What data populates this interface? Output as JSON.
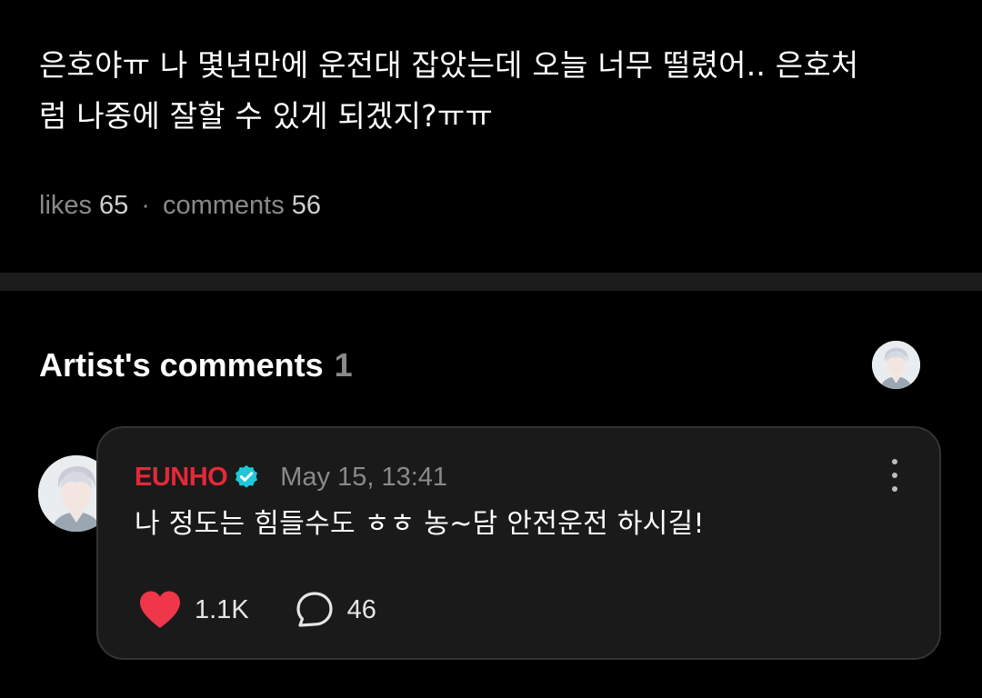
{
  "post": {
    "text_line1": "은호야ㅠ 나 몇년만에 운전대 잡았는데 오늘 너무 떨렸어.. 은호처",
    "text_line2": "럼 나중에 잘할 수 있게 되겠지?ㅠㅠ",
    "likes_label": "likes",
    "likes_count": "65",
    "separator": "·",
    "comments_label": "comments",
    "comments_count": "56"
  },
  "artist_comments": {
    "title": "Artist's comments",
    "count": "1",
    "header_avatar_icon": "artist-avatar-icon"
  },
  "comment": {
    "author": "EUNHO",
    "author_color": "#e4283a",
    "verified_icon": "verified-badge-icon",
    "verified_color": "#1ec8d8",
    "timestamp": "May 15, 13:41",
    "text": "나 정도는 힘들수도 ㅎㅎ 농~담 안전운전 하시길!",
    "like_icon": "heart-icon",
    "like_color": "#f0364b",
    "like_count": "1.1K",
    "reply_icon": "speech-bubble-icon",
    "reply_count": "46",
    "more_icon": "more-vertical-icon"
  }
}
